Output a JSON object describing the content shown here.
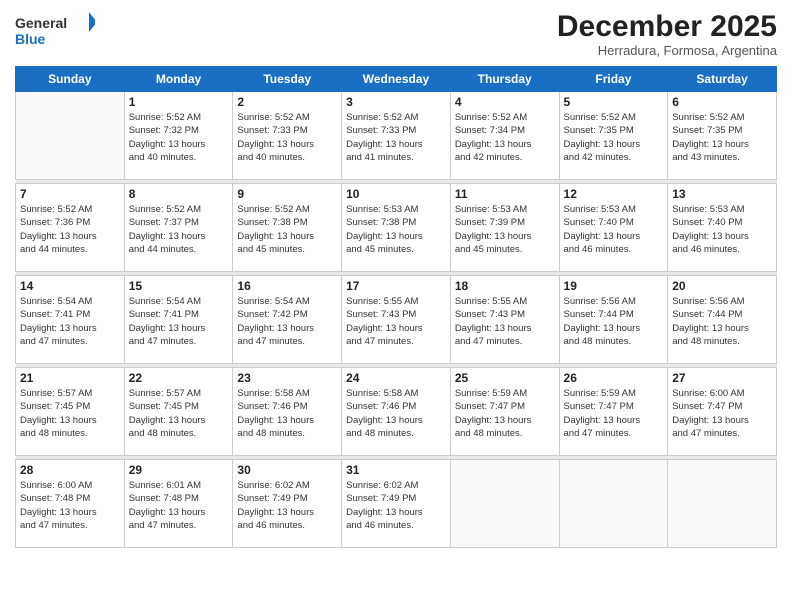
{
  "header": {
    "logo_general": "General",
    "logo_blue": "Blue",
    "title": "December 2025",
    "subtitle": "Herradura, Formosa, Argentina"
  },
  "days": [
    "Sunday",
    "Monday",
    "Tuesday",
    "Wednesday",
    "Thursday",
    "Friday",
    "Saturday"
  ],
  "weeks": [
    [
      {
        "date": "",
        "info": ""
      },
      {
        "date": "1",
        "info": "Sunrise: 5:52 AM\nSunset: 7:32 PM\nDaylight: 13 hours\nand 40 minutes."
      },
      {
        "date": "2",
        "info": "Sunrise: 5:52 AM\nSunset: 7:33 PM\nDaylight: 13 hours\nand 40 minutes."
      },
      {
        "date": "3",
        "info": "Sunrise: 5:52 AM\nSunset: 7:33 PM\nDaylight: 13 hours\nand 41 minutes."
      },
      {
        "date": "4",
        "info": "Sunrise: 5:52 AM\nSunset: 7:34 PM\nDaylight: 13 hours\nand 42 minutes."
      },
      {
        "date": "5",
        "info": "Sunrise: 5:52 AM\nSunset: 7:35 PM\nDaylight: 13 hours\nand 42 minutes."
      },
      {
        "date": "6",
        "info": "Sunrise: 5:52 AM\nSunset: 7:35 PM\nDaylight: 13 hours\nand 43 minutes."
      }
    ],
    [
      {
        "date": "7",
        "info": "Sunrise: 5:52 AM\nSunset: 7:36 PM\nDaylight: 13 hours\nand 44 minutes."
      },
      {
        "date": "8",
        "info": "Sunrise: 5:52 AM\nSunset: 7:37 PM\nDaylight: 13 hours\nand 44 minutes."
      },
      {
        "date": "9",
        "info": "Sunrise: 5:52 AM\nSunset: 7:38 PM\nDaylight: 13 hours\nand 45 minutes."
      },
      {
        "date": "10",
        "info": "Sunrise: 5:53 AM\nSunset: 7:38 PM\nDaylight: 13 hours\nand 45 minutes."
      },
      {
        "date": "11",
        "info": "Sunrise: 5:53 AM\nSunset: 7:39 PM\nDaylight: 13 hours\nand 45 minutes."
      },
      {
        "date": "12",
        "info": "Sunrise: 5:53 AM\nSunset: 7:40 PM\nDaylight: 13 hours\nand 46 minutes."
      },
      {
        "date": "13",
        "info": "Sunrise: 5:53 AM\nSunset: 7:40 PM\nDaylight: 13 hours\nand 46 minutes."
      }
    ],
    [
      {
        "date": "14",
        "info": "Sunrise: 5:54 AM\nSunset: 7:41 PM\nDaylight: 13 hours\nand 47 minutes."
      },
      {
        "date": "15",
        "info": "Sunrise: 5:54 AM\nSunset: 7:41 PM\nDaylight: 13 hours\nand 47 minutes."
      },
      {
        "date": "16",
        "info": "Sunrise: 5:54 AM\nSunset: 7:42 PM\nDaylight: 13 hours\nand 47 minutes."
      },
      {
        "date": "17",
        "info": "Sunrise: 5:55 AM\nSunset: 7:43 PM\nDaylight: 13 hours\nand 47 minutes."
      },
      {
        "date": "18",
        "info": "Sunrise: 5:55 AM\nSunset: 7:43 PM\nDaylight: 13 hours\nand 47 minutes."
      },
      {
        "date": "19",
        "info": "Sunrise: 5:56 AM\nSunset: 7:44 PM\nDaylight: 13 hours\nand 48 minutes."
      },
      {
        "date": "20",
        "info": "Sunrise: 5:56 AM\nSunset: 7:44 PM\nDaylight: 13 hours\nand 48 minutes."
      }
    ],
    [
      {
        "date": "21",
        "info": "Sunrise: 5:57 AM\nSunset: 7:45 PM\nDaylight: 13 hours\nand 48 minutes."
      },
      {
        "date": "22",
        "info": "Sunrise: 5:57 AM\nSunset: 7:45 PM\nDaylight: 13 hours\nand 48 minutes."
      },
      {
        "date": "23",
        "info": "Sunrise: 5:58 AM\nSunset: 7:46 PM\nDaylight: 13 hours\nand 48 minutes."
      },
      {
        "date": "24",
        "info": "Sunrise: 5:58 AM\nSunset: 7:46 PM\nDaylight: 13 hours\nand 48 minutes."
      },
      {
        "date": "25",
        "info": "Sunrise: 5:59 AM\nSunset: 7:47 PM\nDaylight: 13 hours\nand 48 minutes."
      },
      {
        "date": "26",
        "info": "Sunrise: 5:59 AM\nSunset: 7:47 PM\nDaylight: 13 hours\nand 47 minutes."
      },
      {
        "date": "27",
        "info": "Sunrise: 6:00 AM\nSunset: 7:47 PM\nDaylight: 13 hours\nand 47 minutes."
      }
    ],
    [
      {
        "date": "28",
        "info": "Sunrise: 6:00 AM\nSunset: 7:48 PM\nDaylight: 13 hours\nand 47 minutes."
      },
      {
        "date": "29",
        "info": "Sunrise: 6:01 AM\nSunset: 7:48 PM\nDaylight: 13 hours\nand 47 minutes."
      },
      {
        "date": "30",
        "info": "Sunrise: 6:02 AM\nSunset: 7:49 PM\nDaylight: 13 hours\nand 46 minutes."
      },
      {
        "date": "31",
        "info": "Sunrise: 6:02 AM\nSunset: 7:49 PM\nDaylight: 13 hours\nand 46 minutes."
      },
      {
        "date": "",
        "info": ""
      },
      {
        "date": "",
        "info": ""
      },
      {
        "date": "",
        "info": ""
      }
    ]
  ]
}
